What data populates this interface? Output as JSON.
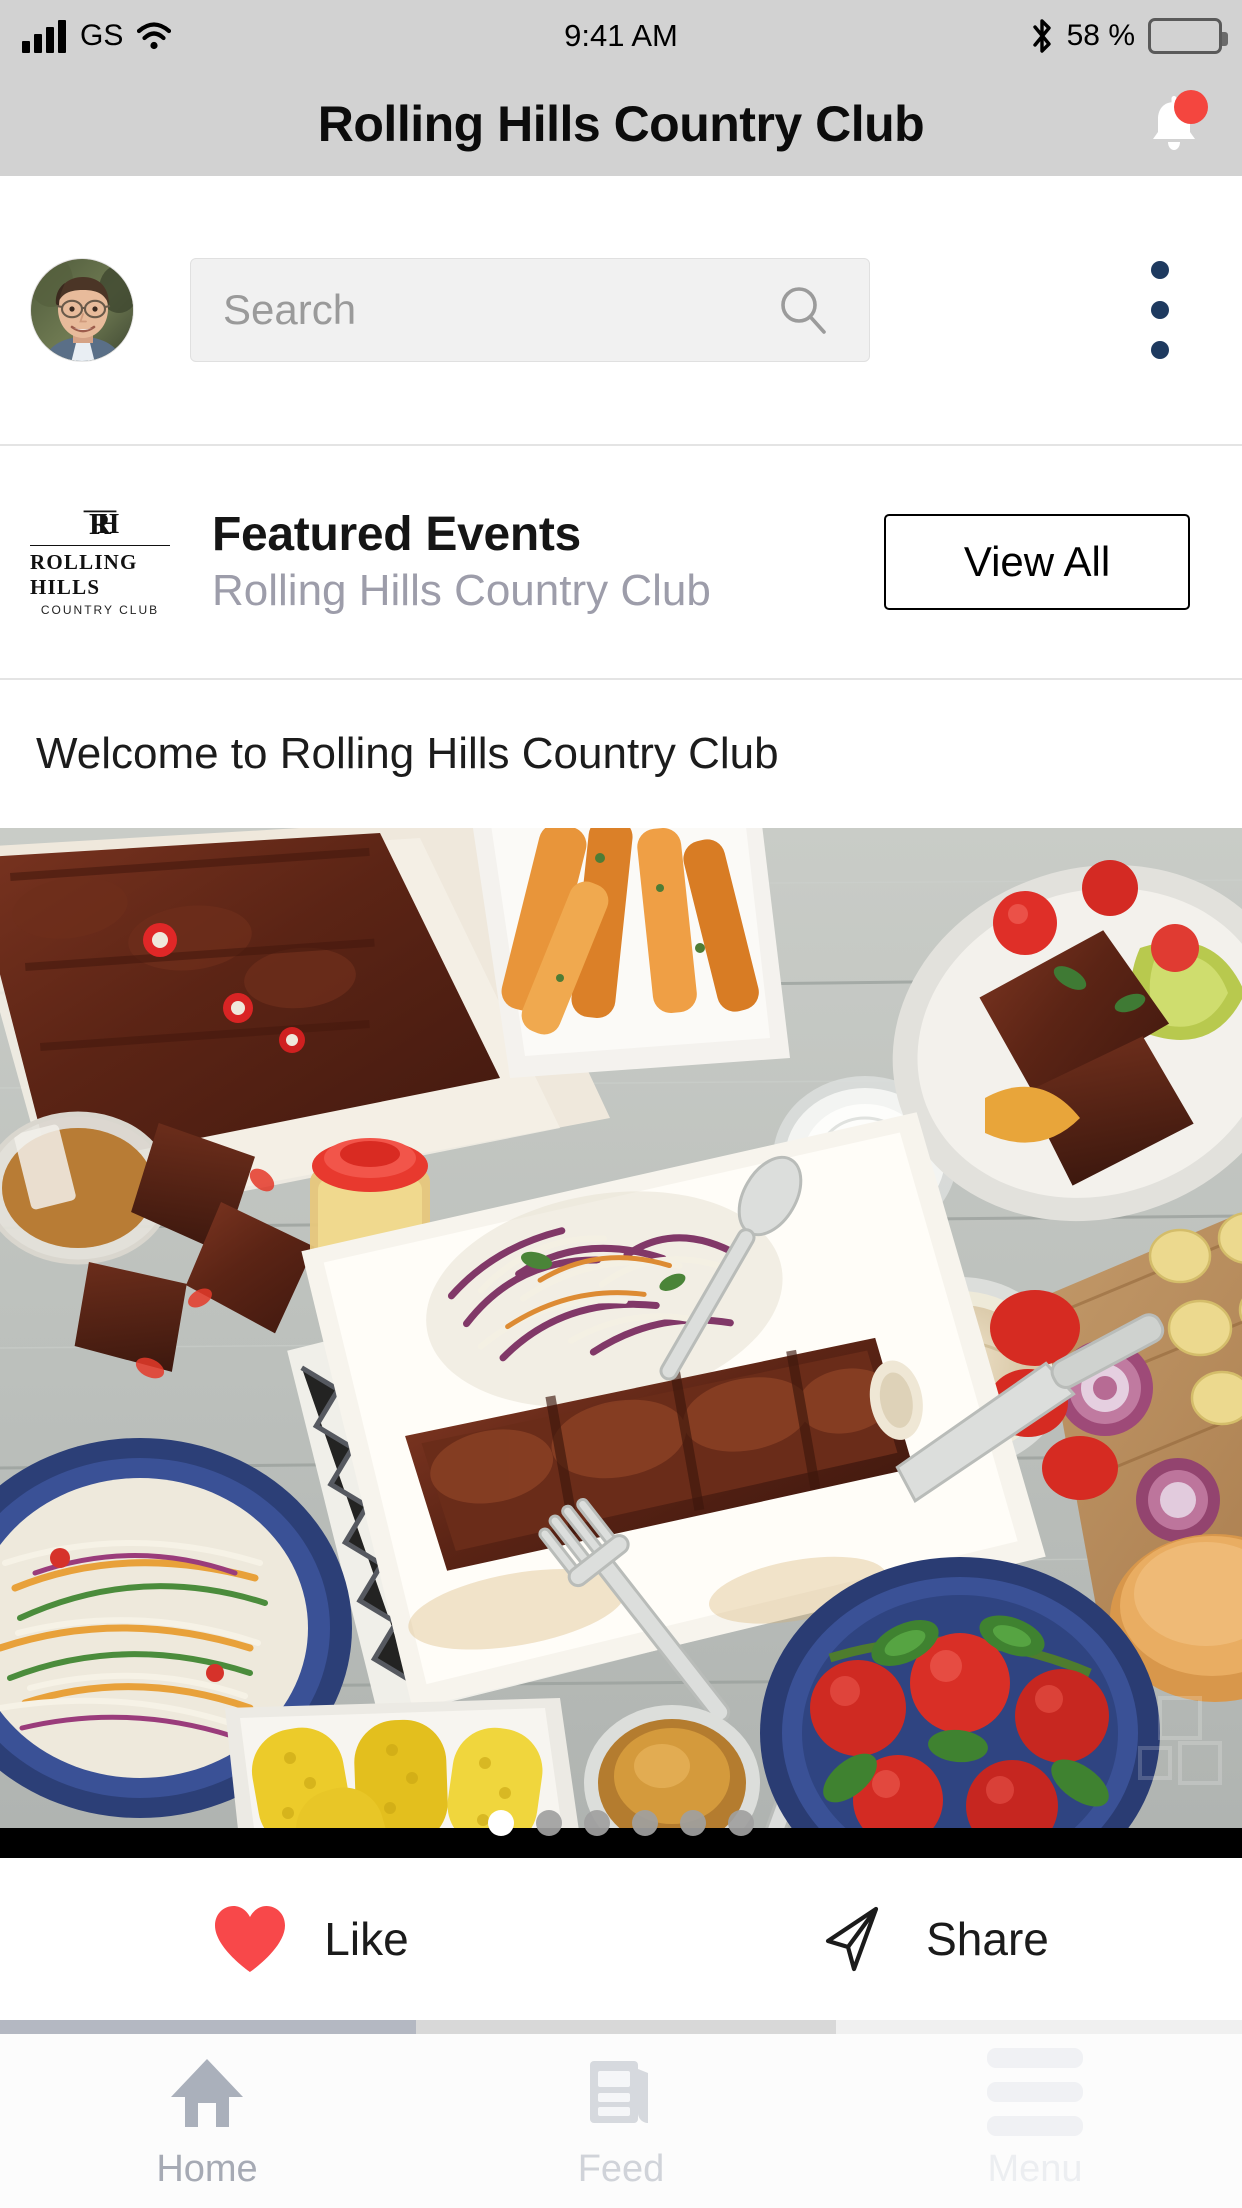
{
  "status_bar": {
    "carrier": "GS",
    "signal_icon": "signal-bars-icon",
    "wifi_icon": "wifi-icon",
    "time": "9:41 AM",
    "bluetooth_icon": "bluetooth-icon",
    "battery_percent": "58 %",
    "battery_level": 58,
    "battery_icon": "battery-icon"
  },
  "header": {
    "title": "Rolling Hills Country Club",
    "notification_icon": "bell-icon",
    "badge_color": "#f4463f",
    "background_color": "#d2d2d2"
  },
  "search": {
    "avatar_name": "user-avatar",
    "placeholder": "Search",
    "value": "",
    "search_icon": "magnifier-icon",
    "overflow_icon": "kebab-menu-icon",
    "overflow_color": "#1e3a5f"
  },
  "featured": {
    "logo_monogram": "RH",
    "logo_line1": "ROLLING HILLS",
    "logo_line2": "COUNTRY CLUB",
    "title": "Featured Events",
    "subtitle": "Rolling Hills Country Club",
    "view_all_label": "View All"
  },
  "post": {
    "caption": "Welcome to Rolling Hills Country Club",
    "image_alt": "barbecue-feast-photo",
    "carousel": {
      "total": 6,
      "active_index": 0
    },
    "actions": [
      {
        "name": "like",
        "label": "Like",
        "icon": "heart-icon",
        "icon_color": "#f8484a"
      },
      {
        "name": "share",
        "label": "Share",
        "icon": "send-icon",
        "icon_color": "#1b1b1b"
      }
    ]
  },
  "progress_segments": [
    {
      "color": "#b4b8c2"
    },
    {
      "color": "#d8d8d8"
    },
    {
      "color": "#f0f0f0"
    }
  ],
  "tabbar": {
    "items": [
      {
        "label": "Home",
        "icon": "home-icon",
        "active": true
      },
      {
        "label": "Feed",
        "icon": "newspaper-icon",
        "active": false
      },
      {
        "label": "Menu",
        "icon": "hamburger-icon",
        "active": false
      }
    ]
  }
}
